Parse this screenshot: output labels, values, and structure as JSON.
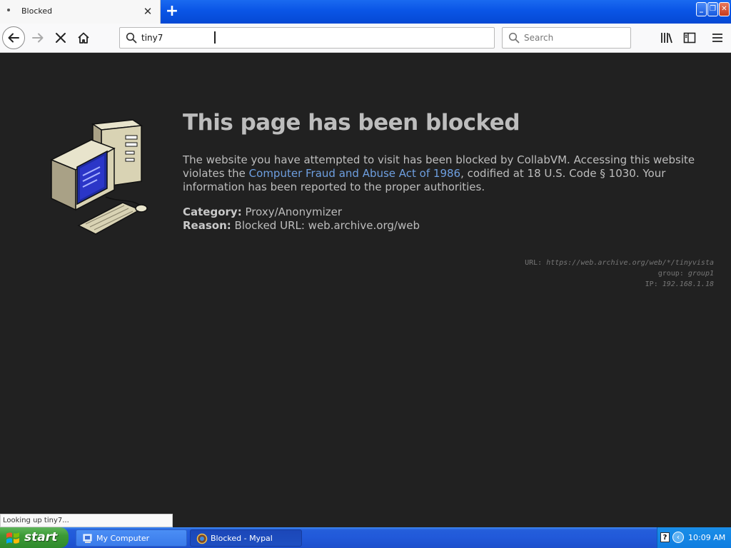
{
  "tab": {
    "title": "Blocked"
  },
  "nav": {
    "url": "tiny7",
    "search_placeholder": "Search"
  },
  "page": {
    "title": "This page has been blocked",
    "desc_before": "The website you have attempted to visit has been blocked by CollabVM. Accessing this website violates the ",
    "desc_link": "Computer Fraud and Abuse Act of 1986",
    "desc_after": ", codified at 18 U.S. Code § 1030. Your information has been reported to the proper authorities.",
    "category_label": "Category:",
    "category_value": "Proxy/Anonymizer",
    "reason_label": "Reason:",
    "reason_value": "Blocked URL: web.archive.org/web",
    "debug_url_label": "URL:",
    "debug_url_value": "https://web.archive.org/web/*/tinyvista",
    "debug_group_label": "group:",
    "debug_group_value": "group1",
    "debug_ip_label": "IP:",
    "debug_ip_value": "192.168.1.18"
  },
  "status": {
    "text": "Looking up tiny7..."
  },
  "taskbar": {
    "start_label": "start",
    "tasks": [
      {
        "label": "My Computer"
      },
      {
        "label": "Blocked - Mypal"
      }
    ],
    "clock": "10:09 AM",
    "help_glyph": "?",
    "chevron_glyph": "‹"
  },
  "colors": {
    "background": "#212121",
    "text": "#bdbdbd",
    "link": "#6e9fe0",
    "taskbar": "#245edb",
    "start": "#3c9a36"
  }
}
